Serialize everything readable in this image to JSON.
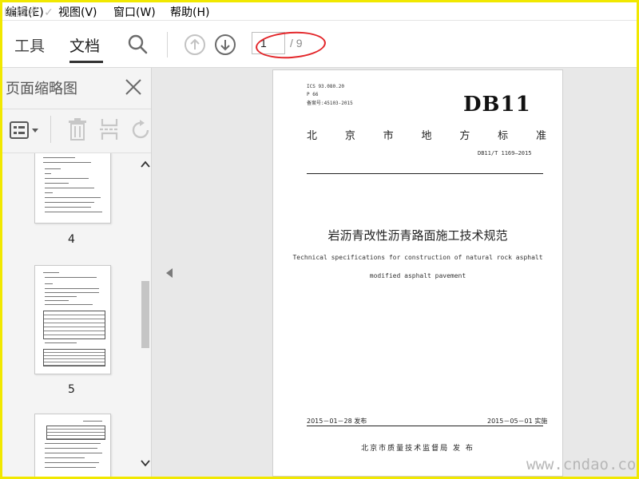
{
  "menu": {
    "items": [
      "编辑(E)",
      "视图(V)",
      "窗口(W)",
      "帮助(H)"
    ],
    "overlay_logo": "IT技术 ✓"
  },
  "toolbar": {
    "tab_tools": "工具",
    "tab_document": "文档",
    "page_current": "1",
    "page_total": "/ 9"
  },
  "panel": {
    "title": "页面缩略图",
    "thumbnails": [
      {
        "label": "4"
      },
      {
        "label": "5"
      }
    ]
  },
  "document": {
    "ics": "ICS 93.080.20",
    "class_code": "P 66",
    "record_no": "备案号:45103-2015",
    "db_code": "DB11",
    "std_type_chars": [
      "北",
      "京",
      "市",
      "地",
      "方",
      "标",
      "准"
    ],
    "std_number": "DB11/T 1169—2015",
    "title_cn": "岩沥青改性沥青路面施工技术规范",
    "title_en_line1": "Technical specifications for construction of natural rock asphalt",
    "title_en_line2": "modified asphalt pavement",
    "issue_date": "2015－01－28 发布",
    "impl_date": "2015－05－01 实施",
    "publisher": "北京市质量技术监督局    发 布"
  },
  "watermark": "www.cndao.com",
  "colors": {
    "frame": "#f1e800",
    "annotation": "#e3262a",
    "icon": "#6b6b6b"
  }
}
